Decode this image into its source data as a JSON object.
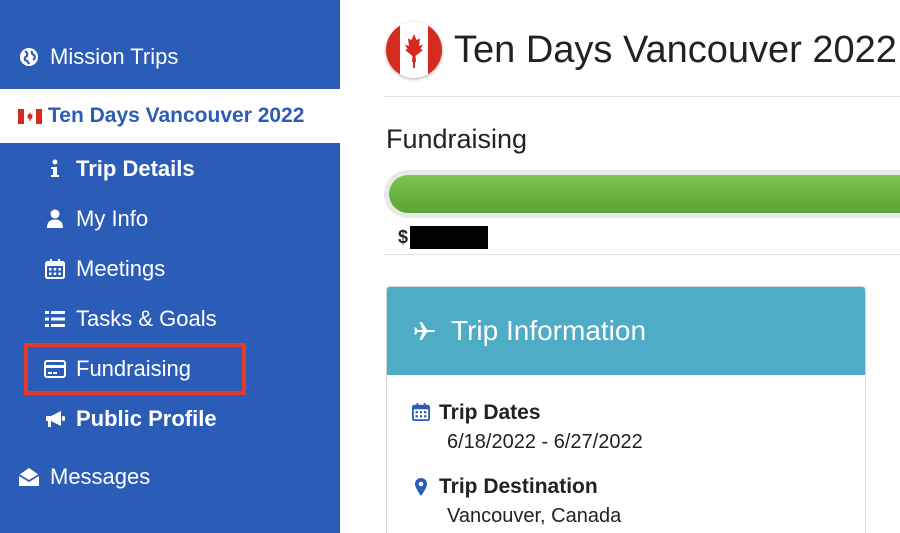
{
  "sidebar": {
    "mission_trips": "Mission Trips",
    "active_trip": "Ten Days Vancouver 2022",
    "items": [
      {
        "label": "Trip Details",
        "icon": "info-icon",
        "bold": true
      },
      {
        "label": "My Info",
        "icon": "user-icon",
        "bold": false
      },
      {
        "label": "Meetings",
        "icon": "calendar-icon",
        "bold": false
      },
      {
        "label": "Tasks & Goals",
        "icon": "list-icon",
        "bold": false
      },
      {
        "label": "Fundraising",
        "icon": "credit-card-icon",
        "bold": false
      },
      {
        "label": "Public Profile",
        "icon": "bullhorn-icon",
        "bold": true
      }
    ],
    "messages": "Messages",
    "colors": {
      "background": "#2b5db8",
      "highlight": "#e83a2a"
    }
  },
  "header": {
    "title": "Ten Days Vancouver 2022",
    "flag": "canada-flag-icon"
  },
  "fundraising": {
    "title": "Fundraising",
    "progress_percent": 100,
    "amount_prefix": "$"
  },
  "trip_info": {
    "title": "Trip Information",
    "header_color": "#4eacc6",
    "dates_label": "Trip Dates",
    "dates_value": "6/18/2022 - 6/27/2022",
    "destination_label": "Trip Destination",
    "destination_value": "Vancouver, Canada"
  }
}
